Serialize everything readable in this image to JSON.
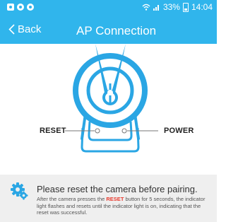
{
  "status": {
    "battery": "33%",
    "time": "14:04"
  },
  "nav": {
    "back_label": "Back",
    "title": "AP Connection"
  },
  "labels": {
    "reset": "RESET",
    "power": "POWER"
  },
  "message": {
    "title": "Please reset the camera before pairing.",
    "body_prefix": "After the camera presses the ",
    "body_highlight": "RESET",
    "body_suffix": " button for 5 seconds, the indicator light flashes and resets until the indicator light is on, indicating that the reset was successful."
  },
  "colors": {
    "accent": "#30b5ec",
    "highlight": "#e83a2e",
    "notice_bg": "#efefef"
  },
  "icons": [
    "image-icon",
    "app-icon",
    "chat-icon",
    "wifi-icon",
    "signal-icon",
    "battery-icon",
    "chevron-left-icon",
    "gear-icon"
  ]
}
